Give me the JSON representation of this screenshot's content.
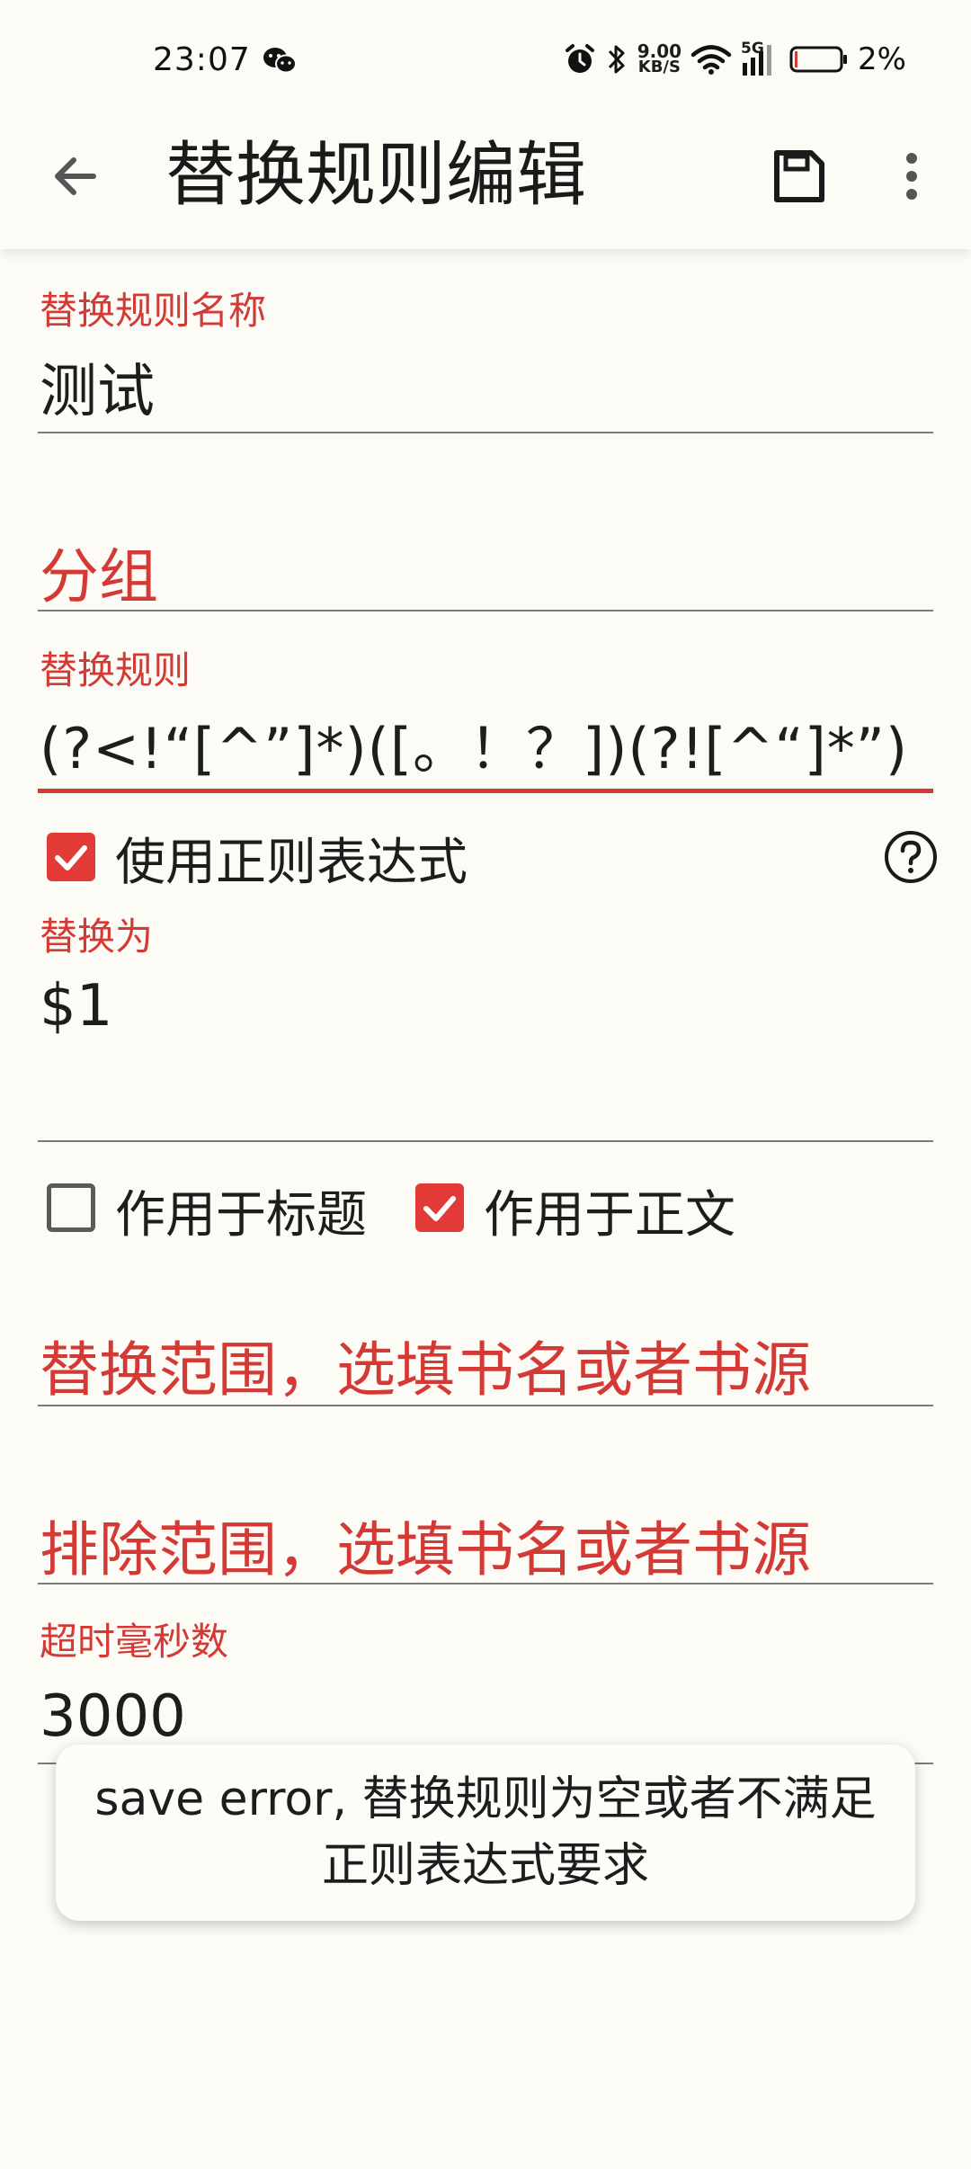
{
  "status_bar": {
    "time": "23:07",
    "net_speed_value": "9.00",
    "net_speed_unit": "KB/S",
    "network": "5G",
    "battery_percent": "2%",
    "icons": [
      "wechat-icon",
      "alarm-icon",
      "bluetooth-icon",
      "wifi-icon",
      "signal-icon",
      "battery-icon"
    ]
  },
  "toolbar": {
    "title": "替换规则编辑",
    "icons": [
      "back-arrow-icon",
      "save-icon",
      "more-vert-icon"
    ]
  },
  "form": {
    "name": {
      "label": "替换规则名称",
      "value": "测试"
    },
    "group": {
      "placeholder": "分组"
    },
    "pattern": {
      "label": "替换规则",
      "value": "(?<!“[^”]*)([。！？])(?![^“]*”)"
    },
    "use_regex": {
      "label": "使用正则表达式",
      "checked": true
    },
    "replacement": {
      "label": "替换为",
      "value": "$1"
    },
    "scope_title": {
      "label": "作用于标题",
      "checked": false
    },
    "scope_content": {
      "label": "作用于正文",
      "checked": true
    },
    "scope": {
      "placeholder": "替换范围，选填书名或者书源"
    },
    "exclude_scope": {
      "placeholder": "排除范围，选填书名或者书源"
    },
    "timeout": {
      "label": "超时毫秒数",
      "value": "3000"
    }
  },
  "toast": {
    "message": "save error, 替换规则为空或者不满足正则表达式要求"
  },
  "colors": {
    "accent": "#d33a35",
    "background": "#fcfbf6",
    "checkbox_checked": "#e23b37"
  }
}
